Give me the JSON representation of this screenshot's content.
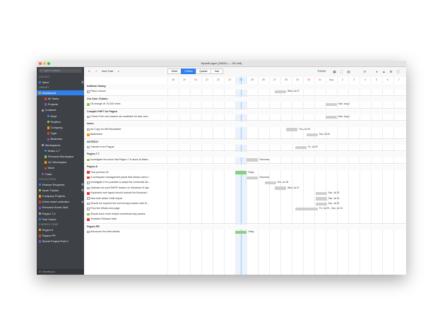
{
  "window": {
    "title": "MyselfLagoo (DEMO — 130 left)"
  },
  "sidebar": {
    "search_placeholder": "Type to search...",
    "sections": [
      {
        "label": "COLLECT",
        "head": true
      },
      {
        "label": "Inbox",
        "badge": "2"
      },
      {
        "label": "LIBRARY",
        "head": true
      },
      {
        "label": "Dashboard",
        "selected": true
      },
      {
        "label": "All Tasks",
        "indent": 2
      },
      {
        "label": "Projects",
        "indent": 2
      },
      {
        "label": "Contacts",
        "indent": 1
      },
      {
        "label": "Dept",
        "indent": 3
      },
      {
        "label": "Position",
        "indent": 3
      },
      {
        "label": "Company",
        "indent": 3
      },
      {
        "label": "Type",
        "indent": 3
      },
      {
        "label": "Business",
        "indent": 3
      },
      {
        "label": "Workspaces",
        "indent": 1
      },
      {
        "label": "Notes 1.7",
        "indent": 2
      },
      {
        "label": "Personal Workspace",
        "indent": 2
      },
      {
        "label": "UC Workspace",
        "indent": 2
      },
      {
        "label": "Work",
        "indent": 2
      },
      {
        "label": "Trash",
        "indent": 1
      },
      {
        "label": "COLLECTIONS",
        "head": true
      },
      {
        "label": "Feature Requests",
        "badge": "78"
      },
      {
        "label": "Issue Tracker",
        "badge": "39"
      },
      {
        "label": "Company Projects"
      },
      {
        "label": "A test smart collection",
        "badge": "3"
      },
      {
        "label": "Personal Home Stuff"
      },
      {
        "label": "Pagico 7.4"
      },
      {
        "label": "Test Cases"
      },
      {
        "label": "STARRED ITEMS",
        "head": true
      },
      {
        "label": "Pagico 8"
      },
      {
        "label": "Pagico PR"
      },
      {
        "label": "Secret Project Part C"
      }
    ],
    "footer": "Standing by"
  },
  "toolbar": {
    "new_task": "New Task",
    "today_label": "TODAY",
    "segments": [
      "Week",
      "2-Week",
      "Quarter",
      "Year"
    ],
    "selected_segment": "2-Week"
  },
  "timeline": {
    "days": [
      "18",
      "19",
      "20",
      "21",
      "22",
      "23",
      "24",
      "25",
      "26",
      "27",
      "28",
      "29",
      "30",
      "31",
      "Aug",
      "2",
      "3",
      "4",
      "5",
      "6",
      "7"
    ],
    "highlight_days": [
      "23",
      "30",
      "31",
      "6",
      "7"
    ],
    "today_index": 6
  },
  "rows": [
    {
      "type": "head",
      "label": "Addison Huang"
    },
    {
      "type": "task",
      "label": "Piano Lesson",
      "bar": {
        "start": 9.5,
        "len": 1,
        "color": "#cfcfcf",
        "label": "Wed, Jul 27"
      }
    },
    {
      "type": "sep"
    },
    {
      "type": "head",
      "label": "Car Care: Subaru"
    },
    {
      "type": "task",
      "label": "Oil change at 70,000 miles",
      "flag": "#8bc34a",
      "bar": {
        "start": 14,
        "len": 1,
        "color": "#cfcfcf",
        "label": "Mon, Aug 1"
      }
    },
    {
      "type": "sep"
    },
    {
      "type": "head",
      "label": "Compile PHP7 for Pagico"
    },
    {
      "type": "task",
      "label": "Check if the new loaders are available for Mac and...",
      "bar": {
        "start": 14,
        "len": 1,
        "color": "#cfcfcf",
        "label": "Mon, Aug 1"
      }
    },
    {
      "type": "sep"
    },
    {
      "type": "head",
      "label": "Inbox"
    },
    {
      "type": "task",
      "label": "Ad Copy for MR Newsletter",
      "bar": {
        "start": 10.5,
        "len": 1,
        "color": "#cfcfcf",
        "label": "Thu, Jul 28"
      }
    },
    {
      "type": "task",
      "label": "Badminton",
      "flag": "#ff9800",
      "bar": {
        "start": 12.3,
        "len": 1,
        "color": "#cfcfcf",
        "label": "Sat, Jul 30"
      }
    },
    {
      "type": "sep"
    },
    {
      "type": "head",
      "label": "NOTES17"
    },
    {
      "type": "task",
      "label": "Transfer from Paypal",
      "bar": {
        "start": 11.3,
        "len": 1,
        "color": "#cfcfcf",
        "label": "Fri, Jul 29"
      }
    },
    {
      "type": "sep"
    },
    {
      "type": "head",
      "label": "Pagico 7.7"
    },
    {
      "type": "task",
      "label": "Investigate the issue that Pagico 7 is stuck at blank...",
      "flag": "#8bc34a",
      "bar": {
        "start": 7,
        "len": 1,
        "color": "#cfcfcf",
        "label": "Tomorrow"
      }
    },
    {
      "type": "sep"
    },
    {
      "type": "head",
      "label": "Pagico 8"
    },
    {
      "type": "task",
      "label": "Post preview #2",
      "flag": "#e53935",
      "bar": {
        "start": 6,
        "len": 1,
        "color": "#8bd17c",
        "label": "Today"
      }
    },
    {
      "type": "task",
      "label": "A workspace management panel that allows users t...",
      "flag": "#e53935",
      "bar": {
        "start": 7,
        "len": 1,
        "color": "#cfcfcf",
        "label": "Tomorrow"
      }
    },
    {
      "type": "task",
      "label": "Investigate if it's possible to adopt the horizontal list...",
      "bar": {
        "start": 8.6,
        "len": 1,
        "color": "#cfcfcf",
        "label": "Tue, Jul 26"
      }
    },
    {
      "type": "task",
      "label": "Optimize the printToPDF feature on Windows+5 day",
      "bar": {
        "start": 9.5,
        "len": 1,
        "color": "#cfcfcf",
        "label": "Wed, Jul 27"
      }
    },
    {
      "type": "task",
      "label": "Expanded web layout should include the flowchart...",
      "flag": "#e53935",
      "bar": {
        "start": 13.1,
        "len": 1,
        "color": "#cfcfcf",
        "label": "Sun, Jul 31"
      }
    },
    {
      "type": "task",
      "label": "New bulk action: Bulk export",
      "bar": {
        "start": 13.1,
        "len": 1,
        "color": "#cfcfcf",
        "label": "Sun, Jul 31"
      }
    },
    {
      "type": "task",
      "label": "Should we improve the current log browser with th...",
      "bar": {
        "start": 13.1,
        "len": 1,
        "color": "#cfcfcf",
        "label": "Sun, Jul 31"
      }
    },
    {
      "type": "task",
      "label": "Prep the Whats-new page",
      "bar": {
        "start": 11.3,
        "len": 2,
        "color": "#cfcfcf",
        "label": "Fri, Jul 29 – Sun, Jul 31"
      }
    },
    {
      "type": "task",
      "label": "Should have more helpful contextual help panels",
      "flag": "#8bc34a"
    },
    {
      "type": "task",
      "label": "Tentative Release Date",
      "flag": "#e53935"
    },
    {
      "type": "sep"
    },
    {
      "type": "head",
      "label": "Pagico PR"
    },
    {
      "type": "task",
      "label": "Announce the beta details",
      "bar": {
        "start": 6,
        "len": 1,
        "color": "#8bd17c",
        "label": "Today"
      }
    }
  ],
  "colors": {
    "accent": "#2f80ed",
    "sidebar_bg": "#3e4247"
  }
}
